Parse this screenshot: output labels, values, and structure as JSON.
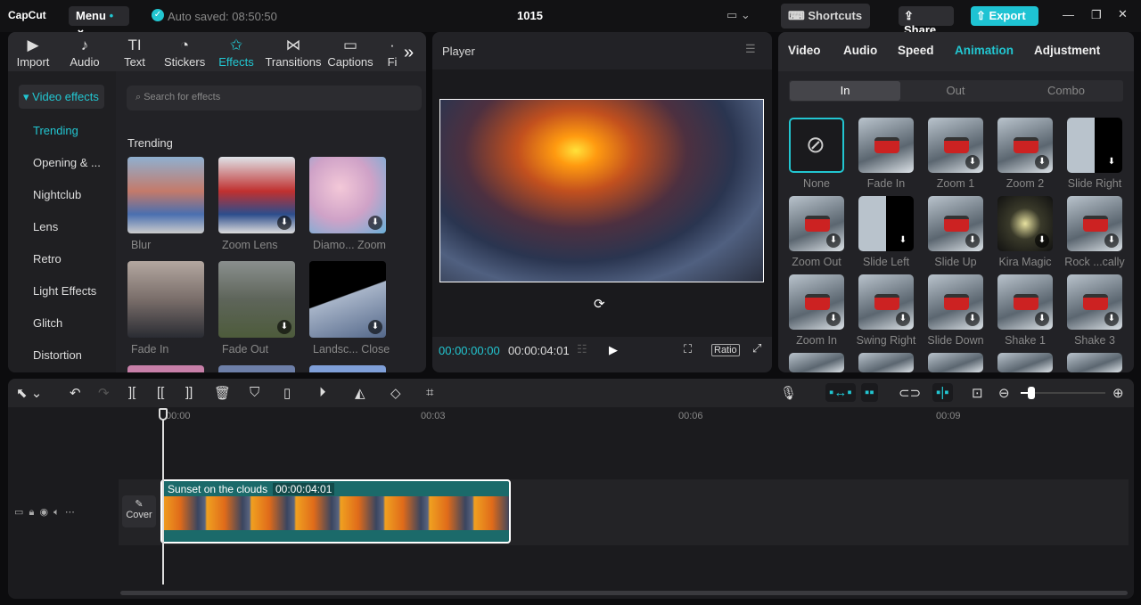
{
  "app": {
    "logo": "CapCut",
    "menu": "Menu",
    "autosave": "Auto saved: 08:50:50",
    "title": "1015",
    "shortcuts": "Shortcuts",
    "share": "Share",
    "export": "Export"
  },
  "tabs": [
    {
      "label": "Import",
      "icon": "▶"
    },
    {
      "label": "Audio",
      "icon": "♪"
    },
    {
      "label": "Text",
      "icon": "TI"
    },
    {
      "label": "Stickers",
      "icon": "◔"
    },
    {
      "label": "Effects",
      "icon": "✩"
    },
    {
      "label": "Transitions",
      "icon": "⋈"
    },
    {
      "label": "Captions",
      "icon": "▭"
    },
    {
      "label": "Fi",
      "icon": "·"
    }
  ],
  "sidebar": {
    "header": "Video effects",
    "items": [
      "Trending",
      "Opening & ...",
      "Nightclub",
      "Lens",
      "Retro",
      "Light Effects",
      "Glitch",
      "Distortion"
    ]
  },
  "search": {
    "placeholder": "Search for effects"
  },
  "effects": {
    "section": "Trending",
    "items": [
      "Blur",
      "Zoom Lens",
      "Diamo... Zoom",
      "Fade In",
      "Fade Out",
      "Landsc... Close"
    ]
  },
  "player": {
    "title": "Player",
    "current": "00:00:00:00",
    "total": "00:00:04:01",
    "ratio": "Ratio"
  },
  "right": {
    "tabs": [
      "Video",
      "Audio",
      "Speed",
      "Animation",
      "Adjustment"
    ],
    "subtabs": [
      "In",
      "Out",
      "Combo"
    ],
    "animations": [
      "None",
      "Fade In",
      "Zoom 1",
      "Zoom 2",
      "Slide Right",
      "Zoom Out",
      "Slide Left",
      "Slide Up",
      "Kira Magic",
      "Rock ...cally",
      "Zoom In",
      "Swing Right",
      "Slide Down",
      "Shake 1",
      "Shake 3"
    ]
  },
  "timeline": {
    "ruler": [
      "00:00",
      "00:03",
      "00:06",
      "00:09"
    ],
    "clip_name": "Sunset on the clouds",
    "clip_duration": "00:00:04:01",
    "cover": "Cover"
  },
  "colors": {
    "accent": "#22c6d1",
    "export": "#1ec3d3"
  }
}
